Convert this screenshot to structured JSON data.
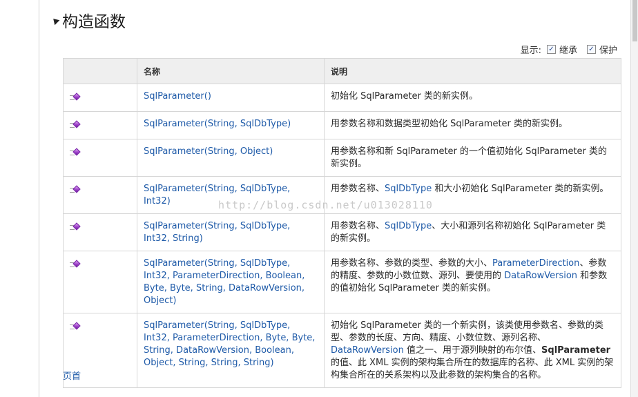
{
  "section": {
    "title": "构造函数"
  },
  "filter": {
    "label": "显示:",
    "inherited": "继承",
    "protected": "保护"
  },
  "table": {
    "headers": {
      "name": "名称",
      "description": "说明"
    },
    "rows": [
      {
        "name": "SqlParameter()",
        "desc": [
          {
            "t": "初始化 SqlParameter 类的新实例。"
          }
        ]
      },
      {
        "name": "SqlParameter(String, SqlDbType)",
        "desc": [
          {
            "t": "用参数名称和数据类型初始化 SqlParameter 类的新实例。"
          }
        ]
      },
      {
        "name": "SqlParameter(String, Object)",
        "desc": [
          {
            "t": "用参数名称和新 SqlParameter 的一个值初始化 SqlParameter 类的新实例。"
          }
        ]
      },
      {
        "name": "SqlParameter(String, SqlDbType, Int32)",
        "desc": [
          {
            "t": "用参数名称、"
          },
          {
            "t": "SqlDbType",
            "link": true
          },
          {
            "t": " 和大小初始化 SqlParameter 类的新实例。"
          }
        ]
      },
      {
        "name": "SqlParameter(String, SqlDbType, Int32, String)",
        "desc": [
          {
            "t": "用参数名称、"
          },
          {
            "t": "SqlDbType",
            "link": true
          },
          {
            "t": "、大小和源列名称初始化 SqlParameter 类的新实例。"
          }
        ]
      },
      {
        "name": "SqlParameter(String, SqlDbType, Int32, ParameterDirection, Boolean, Byte, Byte, String, DataRowVersion, Object)",
        "desc": [
          {
            "t": "用参数名称、参数的类型、参数的大小、"
          },
          {
            "t": "ParameterDirection",
            "link": true
          },
          {
            "t": "、参数的精度、参数的小数位数、源列、要使用的 "
          },
          {
            "t": "DataRowVersion",
            "link": true
          },
          {
            "t": " 和参数的值初始化 SqlParameter 类的新实例。"
          }
        ]
      },
      {
        "name": "SqlParameter(String, SqlDbType, Int32, ParameterDirection, Byte, Byte, String, DataRowVersion, Boolean, Object, String, String, String)",
        "desc": [
          {
            "t": "初始化 SqlParameter 类的一个新实例，该类使用参数名、参数的类型、参数的长度、方向、精度、小数位数、源列名称、"
          },
          {
            "t": "DataRowVersion",
            "link": true
          },
          {
            "t": " 值之一、用于源列映射的布尔值、"
          },
          {
            "t": "SqlParameter",
            "bold": true
          },
          {
            "t": " 的值、此 XML 实例的架构集合所在的数据库的名称、此 XML 实例的架构集合所在的关系架构以及此参数的架构集合的名称。"
          }
        ]
      }
    ]
  },
  "watermark": "http://blog.csdn.net/u013028110",
  "footer": {
    "link": "页首"
  }
}
